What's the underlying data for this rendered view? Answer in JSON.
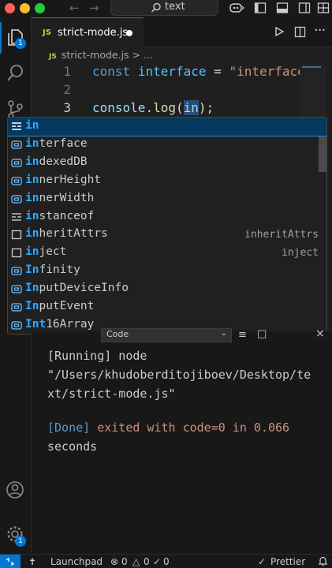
{
  "titlebar": {
    "search_text": "text",
    "traffic_light_colors": [
      "#ff5f57",
      "#febc2e",
      "#28c840"
    ]
  },
  "activity_bar": {
    "explorer_badge": "1",
    "settings_badge": "1",
    "accent": "#0078d4"
  },
  "tab": {
    "lang_badge": "JS",
    "filename": "strict-mode.js"
  },
  "breadcrumb": {
    "lang_badge": "JS",
    "filename": "strict-mode.js",
    "trail": "> ..."
  },
  "editor": {
    "lines": [
      {
        "number": "1",
        "kw": "const",
        "name": "interface",
        "op": "=",
        "str": "\"interface\""
      },
      {
        "number": "2"
      },
      {
        "number": "3",
        "obj": "console",
        "dot": ".",
        "fn": "log",
        "open": "(",
        "arg": "in",
        "close": ");"
      }
    ]
  },
  "suggest": {
    "items": [
      {
        "match": "in",
        "rest": "",
        "kind": "keyword",
        "detail": ""
      },
      {
        "match": "in",
        "rest": "terface",
        "kind": "variable",
        "detail": ""
      },
      {
        "match": "in",
        "rest": "dexedDB",
        "kind": "variable",
        "detail": ""
      },
      {
        "match": "in",
        "rest": "nerHeight",
        "kind": "variable",
        "detail": ""
      },
      {
        "match": "in",
        "rest": "nerWidth",
        "kind": "variable",
        "detail": ""
      },
      {
        "match": "in",
        "rest": "stanceof",
        "kind": "keyword",
        "detail": ""
      },
      {
        "match": "in",
        "rest": "heritAttrs",
        "kind": "text",
        "detail": "inheritAttrs"
      },
      {
        "match": "in",
        "rest": "ject",
        "kind": "text",
        "detail": "inject"
      },
      {
        "match": "In",
        "rest": "finity",
        "kind": "variable",
        "detail": ""
      },
      {
        "match": "In",
        "rest": "putDeviceInfo",
        "kind": "variable",
        "detail": ""
      },
      {
        "match": "In",
        "rest": "putEvent",
        "kind": "variable",
        "detail": ""
      },
      {
        "match": "Int",
        "rest": "16Array",
        "kind": "variable",
        "detail": ""
      }
    ]
  },
  "panel": {
    "dropdown_value": "Code",
    "output": {
      "running": "[Running] node",
      "path_line1": "\"/Users/khudoberditojiboev/Desktop/te",
      "path_line2": "xt/strict-mode.js\"",
      "done_tag": "[Done]",
      "exit_msg": " exited with code=0 in 0.066",
      "exit_msg2": "seconds"
    }
  },
  "statusbar": {
    "launchpad": "Launchpad",
    "errors": "0",
    "warnings": "0",
    "ports": "0",
    "prettier": "Prettier"
  }
}
